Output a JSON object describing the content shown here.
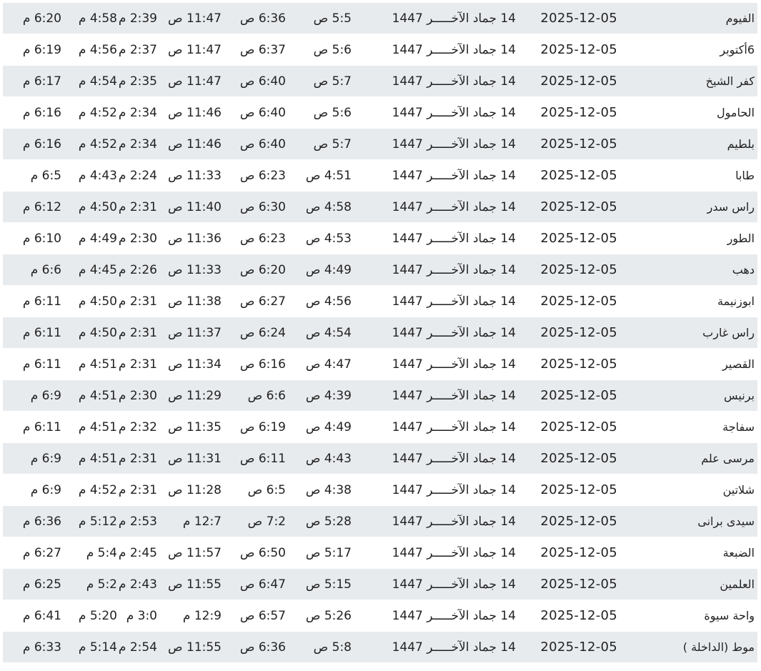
{
  "table": {
    "rows": [
      {
        "city": "الفيوم",
        "date": "2025-12-05",
        "hijri": "14 جماد الآخـــــر 1447",
        "fajr": "5:5 ص",
        "sunrise": "6:36 ص",
        "dhuhr": "11:47 ص",
        "asr": "2:39 م",
        "maghrib": "4:58 م",
        "isha": "6:20 م"
      },
      {
        "city": "6أكتوبر",
        "date": "2025-12-05",
        "hijri": "14 جماد الآخـــــر 1447",
        "fajr": "5:6 ص",
        "sunrise": "6:37 ص",
        "dhuhr": "11:47 ص",
        "asr": "2:37 م",
        "maghrib": "4:56 م",
        "isha": "6:19 م"
      },
      {
        "city": "كفر الشيخ",
        "date": "2025-12-05",
        "hijri": "14 جماد الآخـــــر 1447",
        "fajr": "5:7 ص",
        "sunrise": "6:40 ص",
        "dhuhr": "11:47 ص",
        "asr": "2:35 م",
        "maghrib": "4:54 م",
        "isha": "6:17 م"
      },
      {
        "city": "الحامول",
        "date": "2025-12-05",
        "hijri": "14 جماد الآخـــــر 1447",
        "fajr": "5:6 ص",
        "sunrise": "6:40 ص",
        "dhuhr": "11:46 ص",
        "asr": "2:34 م",
        "maghrib": "4:52 م",
        "isha": "6:16 م"
      },
      {
        "city": "بلطيم",
        "date": "2025-12-05",
        "hijri": "14 جماد الآخـــــر 1447",
        "fajr": "5:7 ص",
        "sunrise": "6:40 ص",
        "dhuhr": "11:46 ص",
        "asr": "2:34 م",
        "maghrib": "4:52 م",
        "isha": "6:16 م"
      },
      {
        "city": "طابا",
        "date": "2025-12-05",
        "hijri": "14 جماد الآخـــــر 1447",
        "fajr": "4:51 ص",
        "sunrise": "6:23 ص",
        "dhuhr": "11:33 ص",
        "asr": "2:24 م",
        "maghrib": "4:43 م",
        "isha": "6:5 م"
      },
      {
        "city": "راس سدر",
        "date": "2025-12-05",
        "hijri": "14 جماد الآخـــــر 1447",
        "fajr": "4:58 ص",
        "sunrise": "6:30 ص",
        "dhuhr": "11:40 ص",
        "asr": "2:31 م",
        "maghrib": "4:50 م",
        "isha": "6:12 م"
      },
      {
        "city": "الطور",
        "date": "2025-12-05",
        "hijri": "14 جماد الآخـــــر 1447",
        "fajr": "4:53 ص",
        "sunrise": "6:23 ص",
        "dhuhr": "11:36 ص",
        "asr": "2:30 م",
        "maghrib": "4:49 م",
        "isha": "6:10 م"
      },
      {
        "city": "دهب",
        "date": "2025-12-05",
        "hijri": "14 جماد الآخـــــر 1447",
        "fajr": "4:49 ص",
        "sunrise": "6:20 ص",
        "dhuhr": "11:33 ص",
        "asr": "2:26 م",
        "maghrib": "4:45 م",
        "isha": "6:6 م"
      },
      {
        "city": "ابوزنيمة",
        "date": "2025-12-05",
        "hijri": "14 جماد الآخـــــر 1447",
        "fajr": "4:56 ص",
        "sunrise": "6:27 ص",
        "dhuhr": "11:38 ص",
        "asr": "2:31 م",
        "maghrib": "4:50 م",
        "isha": "6:11 م"
      },
      {
        "city": "راس غارب",
        "date": "2025-12-05",
        "hijri": "14 جماد الآخـــــر 1447",
        "fajr": "4:54 ص",
        "sunrise": "6:24 ص",
        "dhuhr": "11:37 ص",
        "asr": "2:31 م",
        "maghrib": "4:50 م",
        "isha": "6:11 م"
      },
      {
        "city": "القصير",
        "date": "2025-12-05",
        "hijri": "14 جماد الآخـــــر 1447",
        "fajr": "4:47 ص",
        "sunrise": "6:16 ص",
        "dhuhr": "11:34 ص",
        "asr": "2:31 م",
        "maghrib": "4:51 م",
        "isha": "6:11 م"
      },
      {
        "city": "برنيس",
        "date": "2025-12-05",
        "hijri": "14 جماد الآخـــــر 1447",
        "fajr": "4:39 ص",
        "sunrise": "6:6 ص",
        "dhuhr": "11:29 ص",
        "asr": "2:30 م",
        "maghrib": "4:51 م",
        "isha": "6:9 م"
      },
      {
        "city": "سفاجة",
        "date": "2025-12-05",
        "hijri": "14 جماد الآخـــــر 1447",
        "fajr": "4:49 ص",
        "sunrise": "6:19 ص",
        "dhuhr": "11:35 ص",
        "asr": "2:32 م",
        "maghrib": "4:51 م",
        "isha": "6:11 م"
      },
      {
        "city": "مرسى علم",
        "date": "2025-12-05",
        "hijri": "14 جماد الآخـــــر 1447",
        "fajr": "4:43 ص",
        "sunrise": "6:11 ص",
        "dhuhr": "11:31 ص",
        "asr": "2:31 م",
        "maghrib": "4:51 م",
        "isha": "6:9 م"
      },
      {
        "city": "شلاتين",
        "date": "2025-12-05",
        "hijri": "14 جماد الآخـــــر 1447",
        "fajr": "4:38 ص",
        "sunrise": "6:5 ص",
        "dhuhr": "11:28 ص",
        "asr": "2:31 م",
        "maghrib": "4:52 م",
        "isha": "6:9 م"
      },
      {
        "city": "سيدى برانى",
        "date": "2025-12-05",
        "hijri": "14 جماد الآخـــــر 1447",
        "fajr": "5:28 ص",
        "sunrise": "7:2 ص",
        "dhuhr": "12:7 م",
        "asr": "2:53 م",
        "maghrib": "5:12 م",
        "isha": "6:36 م"
      },
      {
        "city": "الضبعة",
        "date": "2025-12-05",
        "hijri": "14 جماد الآخـــــر 1447",
        "fajr": "5:17 ص",
        "sunrise": "6:50 ص",
        "dhuhr": "11:57 ص",
        "asr": "2:45 م",
        "maghrib": "5:4 م",
        "isha": "6:27 م"
      },
      {
        "city": "العلمين",
        "date": "2025-12-05",
        "hijri": "14 جماد الآخـــــر 1447",
        "fajr": "5:15 ص",
        "sunrise": "6:47 ص",
        "dhuhr": "11:55 ص",
        "asr": "2:43 م",
        "maghrib": "5:2 م",
        "isha": "6:25 م"
      },
      {
        "city": "واحة سيوة",
        "date": "2025-12-05",
        "hijri": "14 جماد الآخـــــر 1447",
        "fajr": "5:26 ص",
        "sunrise": "6:57 ص",
        "dhuhr": "12:9 م",
        "asr": "3:0 م",
        "maghrib": "5:20 م",
        "isha": "6:41 م"
      },
      {
        "city": "موط (الداخلة )",
        "date": "2025-12-05",
        "hijri": "14 جماد الآخـــــر 1447",
        "fajr": "5:8 ص",
        "sunrise": "6:36 ص",
        "dhuhr": "11:55 ص",
        "asr": "2:54 م",
        "maghrib": "5:14 م",
        "isha": "6:33 م"
      }
    ]
  },
  "colors": {
    "shaded_row": "#e8ebee",
    "plain_row": "#ffffff",
    "text": "#222222"
  }
}
